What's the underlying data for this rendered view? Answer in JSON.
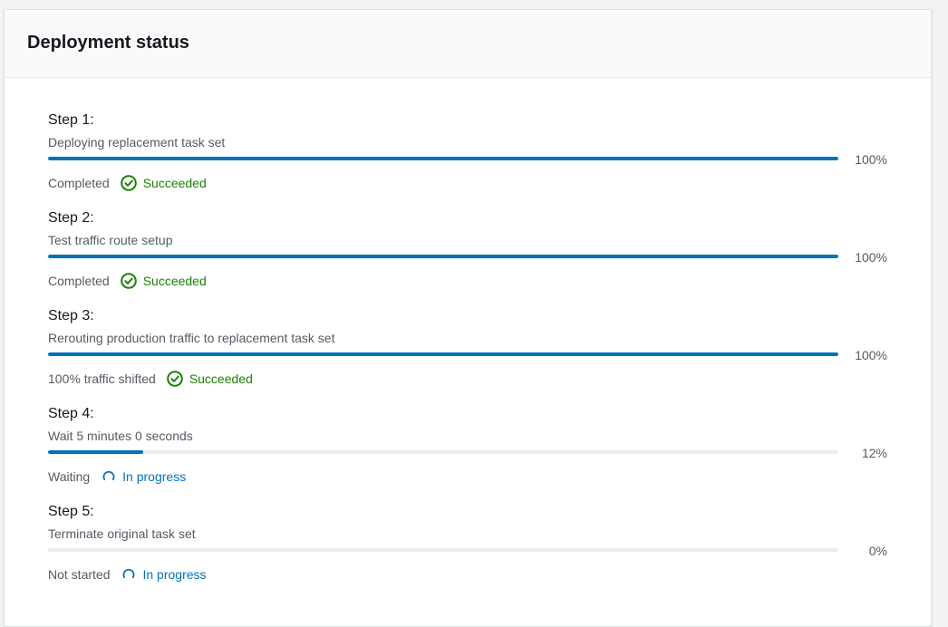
{
  "panel": {
    "title": "Deployment status"
  },
  "steps": [
    {
      "title": "Step 1:",
      "description": "Deploying replacement task set",
      "progress": 100,
      "percent_label": "100%",
      "status_label": "Completed",
      "status_text": "Succeeded",
      "status_icon": "check-circle-icon"
    },
    {
      "title": "Step 2:",
      "description": "Test traffic route setup",
      "progress": 100,
      "percent_label": "100%",
      "status_label": "Completed",
      "status_text": "Succeeded",
      "status_icon": "check-circle-icon"
    },
    {
      "title": "Step 3:",
      "description": "Rerouting production traffic to replacement task set",
      "progress": 100,
      "percent_label": "100%",
      "status_label": "100% traffic shifted",
      "status_text": "Succeeded",
      "status_icon": "check-circle-icon"
    },
    {
      "title": "Step 4:",
      "description": "Wait 5 minutes 0 seconds",
      "progress": 12,
      "percent_label": "12%",
      "status_label": "Waiting",
      "status_text": "In progress",
      "status_icon": "spinner-icon"
    },
    {
      "title": "Step 5:",
      "description": "Terminate original task set",
      "progress": 0,
      "percent_label": "0%",
      "status_label": "Not started",
      "status_text": "In progress",
      "status_icon": "spinner-icon"
    }
  ],
  "colors": {
    "progress_fill": "#0073bb",
    "progress_track": "#eaeded",
    "success": "#1d8102",
    "in_progress": "#0073bb",
    "text_primary": "#16191f",
    "text_secondary": "#545b64"
  }
}
